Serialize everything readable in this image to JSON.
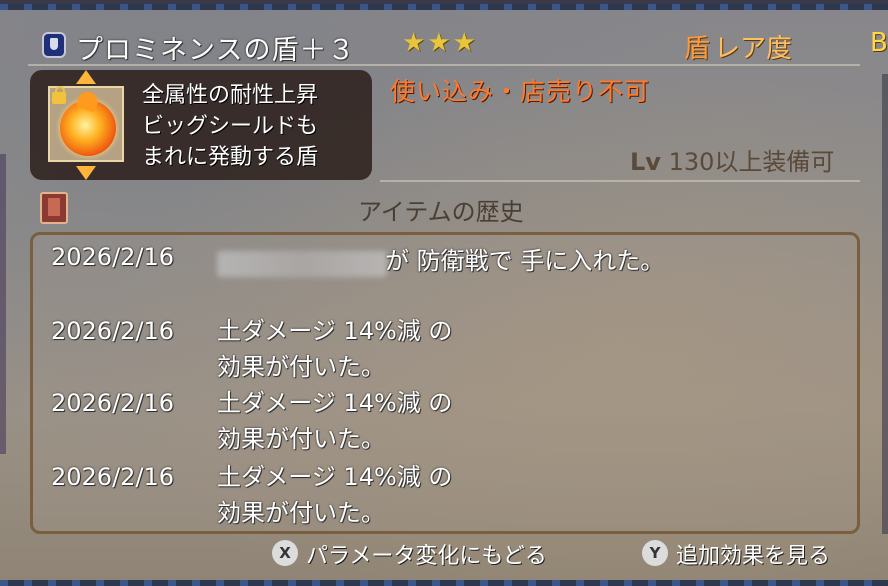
{
  "item": {
    "name": "プロミネンスの盾＋３",
    "stars": "★★★",
    "rarity_kanji": "盾",
    "rarity_label": "レア度",
    "rarity_grade": "B",
    "restriction": "使い込み・店売り不可",
    "level_label": "Lv",
    "level_value": "130",
    "level_suffix": "以上装備可"
  },
  "effect": {
    "text": "全属性の耐性上昇\nビッグシールドも\nまれに発動する盾"
  },
  "history": {
    "title": "アイテムの歴史",
    "entries": [
      {
        "date": "2026/2/16",
        "text": "が 防衛戦で 手に入れた。"
      },
      {
        "date": "2026/2/16",
        "text": "土ダメージ 14%減 の\n効果が付いた。"
      },
      {
        "date": "2026/2/16",
        "text": "土ダメージ 14%減 の\n効果が付いた。"
      },
      {
        "date": "2026/2/16",
        "text": "土ダメージ 14%減 の\n効果が付いた。"
      }
    ]
  },
  "footer": {
    "x_glyph": "X",
    "x_label": "パラメータ変化にもどる",
    "y_glyph": "Y",
    "y_label": "追加効果を見る"
  },
  "icons": {
    "shield_badge": "shield-icon",
    "effect_icon": "fire-shield-icon",
    "lock": "lock-icon",
    "history": "book-icon"
  },
  "colors": {
    "restriction": "#ff7a2a",
    "stars": "#e8c53a",
    "rarity": "#ffb85a"
  }
}
